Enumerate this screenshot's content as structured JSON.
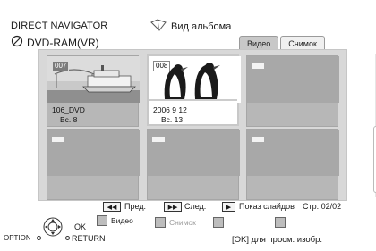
{
  "header": {
    "title": "DIRECT NAVIGATOR",
    "drive": "DVD-RAM(VR)",
    "album_view_label": "Вид альбома"
  },
  "tabs": [
    {
      "label": "Видео",
      "active": false
    },
    {
      "label": "Снимок",
      "active": true
    }
  ],
  "tiles": [
    {
      "badge": "007",
      "line1": "106_DVD",
      "line2": "Вс. 8",
      "has_image": true,
      "scene": "ship",
      "selected": false
    },
    {
      "badge": "008",
      "line1": "2006  9  12",
      "line2": "Вс. 13",
      "has_image": true,
      "scene": "penguins",
      "selected": true
    },
    {
      "badge": "---",
      "line1": "",
      "line2": "",
      "has_image": false,
      "selected": false
    },
    {
      "badge": "---",
      "line1": "",
      "line2": "",
      "has_image": false,
      "selected": false
    },
    {
      "badge": "---",
      "line1": "",
      "line2": "",
      "has_image": false,
      "selected": false
    },
    {
      "badge": "---",
      "line1": "",
      "line2": "",
      "has_image": false,
      "selected": false
    }
  ],
  "navigation": {
    "prev_label": "Пред.",
    "next_label": "След.",
    "slideshow_label": "Показ слайдов",
    "page": "Стр. 02/02"
  },
  "color_keys": [
    {
      "label": "Видео",
      "enabled": true
    },
    {
      "label": "Снимок",
      "enabled": false
    },
    {
      "label": "",
      "enabled": true
    },
    {
      "label": "",
      "enabled": true
    }
  ],
  "remote": {
    "option_label": "OPTION",
    "ok_label": "OK",
    "return_label": "RETURN"
  },
  "hint": "[OK] для просм. изобр.",
  "colors": {
    "panel_bg": "#d8d8d8",
    "tile_bg": "#b7b7b7",
    "selected_bg": "#ffffff",
    "text": "#1a1a1a"
  }
}
